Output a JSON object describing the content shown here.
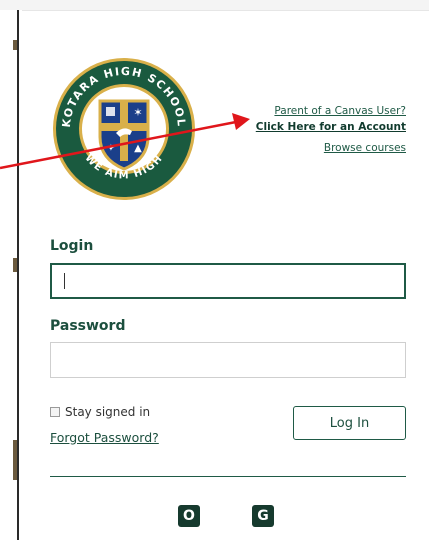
{
  "school": {
    "name_top": "KOTARA HIGH SCHOOL",
    "motto": "WE AIM HIGH"
  },
  "links": {
    "parent_question": "Parent of a Canvas User?",
    "create_account": "Click Here for an Account",
    "browse_courses": "Browse courses"
  },
  "form": {
    "login_label": "Login",
    "login_value": "",
    "password_label": "Password",
    "password_value": "",
    "stay_signed_in": "Stay signed in",
    "forgot_password": "Forgot Password?",
    "login_button": "Log In"
  },
  "sso": {
    "office_icon_glyph": "O",
    "google_icon_glyph": "G"
  },
  "colors": {
    "brand_green": "#1f5a46",
    "dark_green": "#163a2e",
    "crest_gold": "#d9b04a",
    "annotation_red": "#e0161b"
  }
}
